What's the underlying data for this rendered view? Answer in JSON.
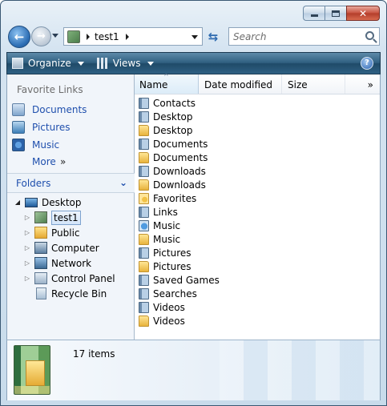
{
  "window": {
    "caption_buttons": {
      "minimize_icon": "minimize-icon",
      "maximize_icon": "maximize-icon",
      "close_glyph": "✕"
    }
  },
  "nav": {
    "back_glyph": "←",
    "forward_glyph": "→",
    "refresh_glyph": "⇆",
    "address": {
      "path_segment": "test1"
    },
    "search": {
      "placeholder": "Search",
      "value": ""
    }
  },
  "command_bar": {
    "organize_label": "Organize",
    "views_label": "Views",
    "help_glyph": "?"
  },
  "favorites": {
    "title": "Favorite Links",
    "items": [
      {
        "label": "Documents",
        "icon": "documents-icon"
      },
      {
        "label": "Pictures",
        "icon": "pictures-icon"
      },
      {
        "label": "Music",
        "icon": "music-icon"
      }
    ],
    "more_label": "More",
    "more_chevron": "»"
  },
  "folders": {
    "label": "Folders",
    "chevron": "⌄",
    "tree": [
      {
        "label": "Desktop",
        "icon": "desktop-icon",
        "toggle": "◢",
        "expanded": true
      },
      {
        "label": "test1",
        "icon": "user-folder-icon",
        "toggle": "▷",
        "selected": true
      },
      {
        "label": "Public",
        "icon": "folder-icon",
        "toggle": "▷"
      },
      {
        "label": "Computer",
        "icon": "computer-icon",
        "toggle": "▷"
      },
      {
        "label": "Network",
        "icon": "network-icon",
        "toggle": "▷"
      },
      {
        "label": "Control Panel",
        "icon": "control-panel-icon",
        "toggle": "▷"
      },
      {
        "label": "Recycle Bin",
        "icon": "recycle-bin-icon",
        "toggle": ""
      }
    ]
  },
  "file_list": {
    "columns": {
      "name": "Name",
      "date_modified": "Date modified",
      "size": "Size",
      "more": "»"
    },
    "sort_arrow": "^",
    "items": [
      {
        "name": "Contacts",
        "icon": "contacts-icon"
      },
      {
        "name": "Desktop",
        "icon": "desktop-special-icon"
      },
      {
        "name": "Desktop",
        "icon": "folder-icon"
      },
      {
        "name": "Documents",
        "icon": "documents-special-icon"
      },
      {
        "name": "Documents",
        "icon": "folder-icon"
      },
      {
        "name": "Downloads",
        "icon": "downloads-special-icon"
      },
      {
        "name": "Downloads",
        "icon": "folder-icon"
      },
      {
        "name": "Favorites",
        "icon": "favorites-icon"
      },
      {
        "name": "Links",
        "icon": "links-icon"
      },
      {
        "name": "Music",
        "icon": "music-special-icon"
      },
      {
        "name": "Music",
        "icon": "folder-icon"
      },
      {
        "name": "Pictures",
        "icon": "pictures-special-icon"
      },
      {
        "name": "Pictures",
        "icon": "folder-icon"
      },
      {
        "name": "Saved Games",
        "icon": "saved-games-icon"
      },
      {
        "name": "Searches",
        "icon": "searches-icon"
      },
      {
        "name": "Videos",
        "icon": "videos-special-icon"
      },
      {
        "name": "Videos",
        "icon": "folder-icon"
      }
    ]
  },
  "details": {
    "count_text": "17 items",
    "icon": "user-folder-large-icon"
  },
  "colors": {
    "command_bar": "#2f5f80",
    "link_blue": "#1f4fad",
    "close_button": "#c7513e"
  }
}
